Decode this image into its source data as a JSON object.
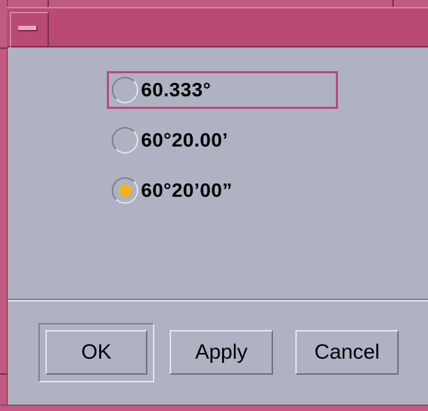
{
  "window": {
    "menu_button_icon": "window-menu-icon",
    "accent_color": "#b84a73",
    "background_color": "#aeb2c3"
  },
  "options": [
    {
      "label": "60.333°",
      "selected": false,
      "focused": true
    },
    {
      "label": "60°20.00’",
      "selected": false,
      "focused": false
    },
    {
      "label": "60°20’00”",
      "selected": true,
      "focused": false
    }
  ],
  "selected_indicator_color": "#f0b41c",
  "buttons": {
    "ok_label": "OK",
    "apply_label": "Apply",
    "cancel_label": "Cancel",
    "default": "ok"
  }
}
